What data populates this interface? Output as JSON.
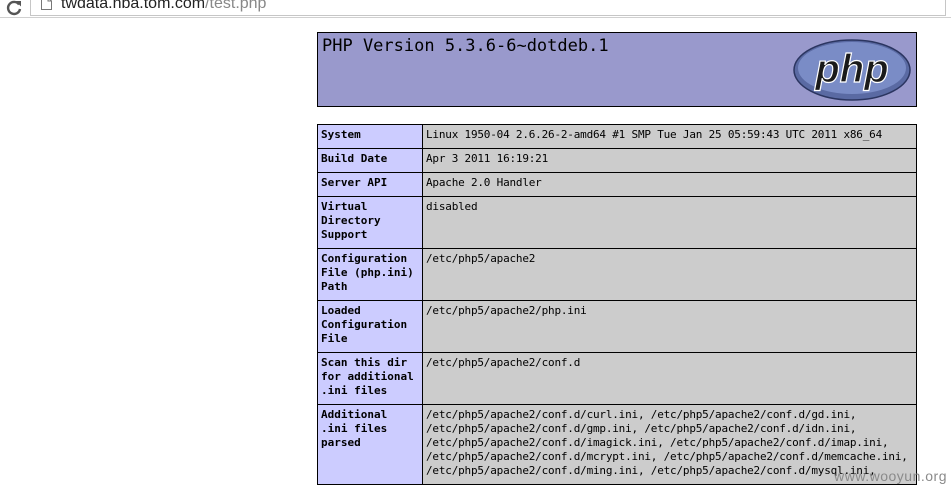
{
  "browser": {
    "url_host": "twdata.nba.tom.com",
    "url_path": "/test.php",
    "reload_icon": "reload-icon",
    "page_icon": "page-icon"
  },
  "header": {
    "title": "PHP Version 5.3.6-6~dotdeb.1",
    "logo_text": "php",
    "colors": {
      "header_bg": "#9999cc",
      "label_bg": "#ccccff",
      "value_bg": "#cccccc",
      "logo_fill": "#6c7eb7"
    }
  },
  "table": {
    "rows": [
      {
        "label": "System",
        "value": "Linux 1950-04 2.6.26-2-amd64 #1 SMP Tue Jan 25 05:59:43 UTC 2011 x86_64"
      },
      {
        "label": "Build Date",
        "value": "Apr 3 2011 16:19:21"
      },
      {
        "label": "Server API",
        "value": "Apache 2.0 Handler"
      },
      {
        "label": "Virtual Directory Support",
        "value": "disabled"
      },
      {
        "label": "Configuration File (php.ini) Path",
        "value": "/etc/php5/apache2"
      },
      {
        "label": "Loaded Configuration File",
        "value": "/etc/php5/apache2/php.ini"
      },
      {
        "label": "Scan this dir for additional .ini files",
        "value": "/etc/php5/apache2/conf.d"
      },
      {
        "label": "Additional .ini files parsed",
        "value": "/etc/php5/apache2/conf.d/curl.ini, /etc/php5/apache2/conf.d/gd.ini, /etc/php5/apache2/conf.d/gmp.ini, /etc/php5/apache2/conf.d/idn.ini, /etc/php5/apache2/conf.d/imagick.ini, /etc/php5/apache2/conf.d/imap.ini, /etc/php5/apache2/conf.d/mcrypt.ini, /etc/php5/apache2/conf.d/memcache.ini, /etc/php5/apache2/conf.d/ming.ini, /etc/php5/apache2/conf.d/mysql.ini,"
      }
    ]
  },
  "watermark": "www.wooyun.org"
}
